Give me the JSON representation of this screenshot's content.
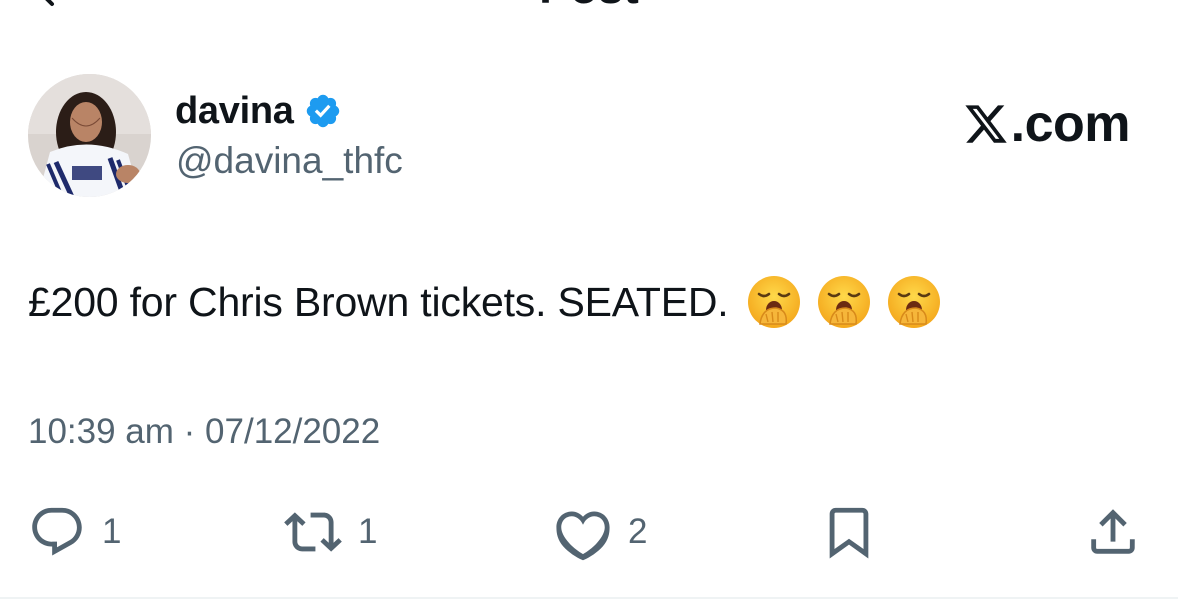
{
  "header": {
    "title": "Post",
    "back_icon": "arrow-left-icon"
  },
  "author": {
    "display_name": "davina",
    "handle": "@davina_thfc",
    "verified": true,
    "verified_color": "#1d9bf0"
  },
  "watermark": {
    "logo": "x-logo-icon",
    "text": ".com"
  },
  "post": {
    "text": "£200 for Chris Brown tickets. SEATED.",
    "emojis": [
      "yawning-face-emoji",
      "yawning-face-emoji",
      "yawning-face-emoji"
    ],
    "timestamp": "10:39 am · 07/12/2022"
  },
  "actions": {
    "reply_count": "1",
    "repost_count": "1",
    "like_count": "2"
  },
  "colors": {
    "text": "#0f1419",
    "secondary_text": "#536471",
    "verified_badge": "#1d9bf0"
  }
}
